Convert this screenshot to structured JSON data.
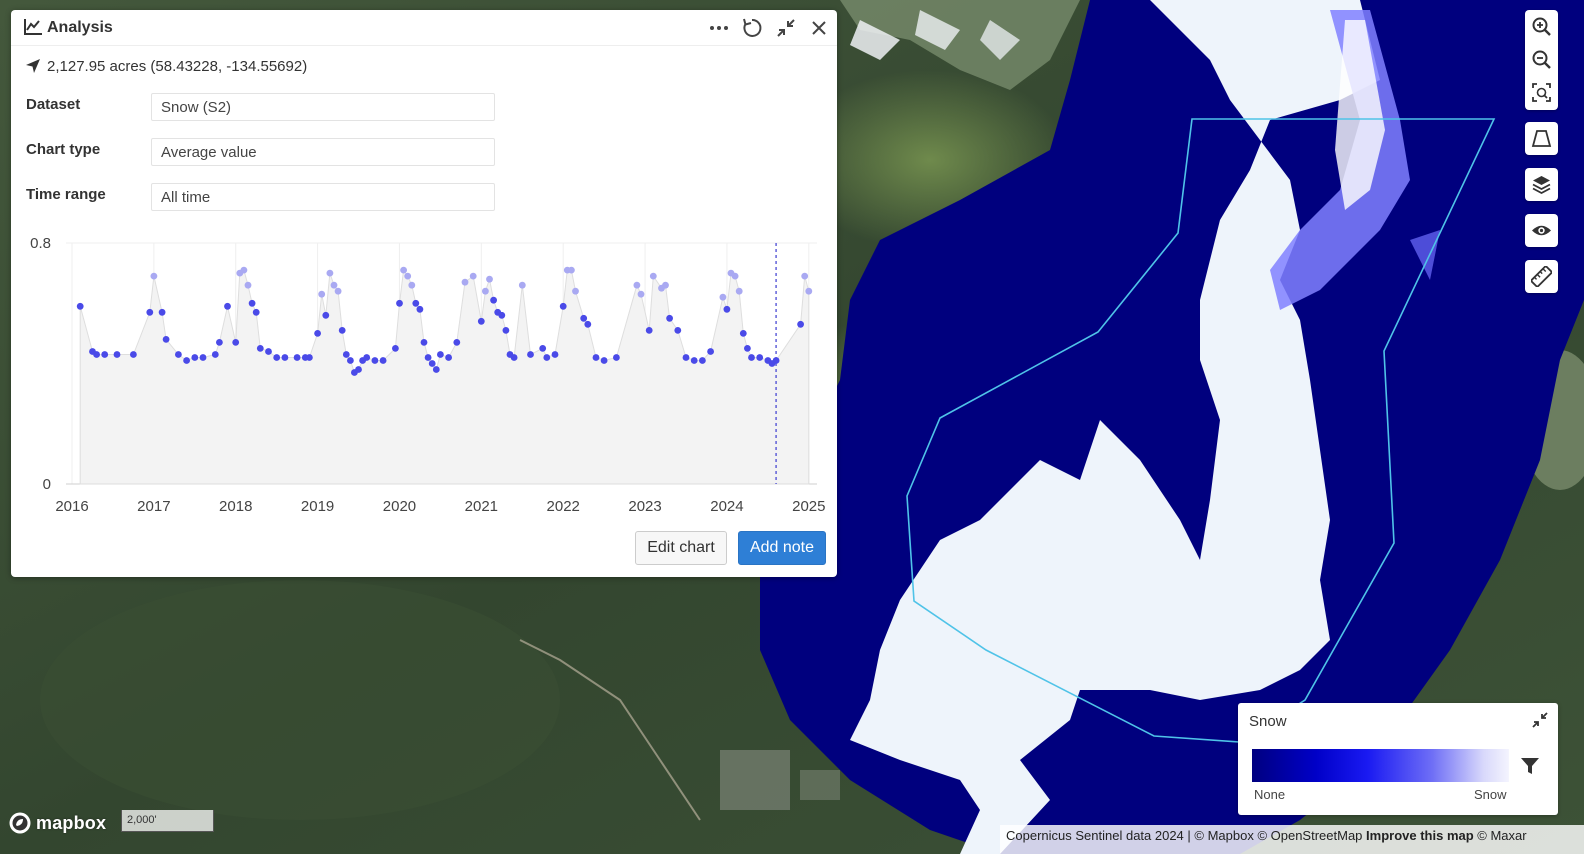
{
  "panel": {
    "title": "Analysis",
    "coords": "2,127.95 acres (58.43228, -134.55692)",
    "fields": [
      {
        "label": "Dataset",
        "value": "Snow (S2)"
      },
      {
        "label": "Chart type",
        "value": "Average value"
      },
      {
        "label": "Time range",
        "value": "All time"
      }
    ],
    "edit_chart_label": "Edit chart",
    "add_note_label": "Add note"
  },
  "chart_data": {
    "type": "scatter",
    "title": "",
    "xlabel": "",
    "ylabel": "",
    "x_ticks": [
      "2016",
      "2017",
      "2018",
      "2019",
      "2020",
      "2021",
      "2022",
      "2023",
      "2024",
      "2025"
    ],
    "y_ticks": [
      "0",
      "0.8"
    ],
    "xlim": [
      2016.0,
      2025.1
    ],
    "ylim": [
      0,
      0.8
    ],
    "marker_line_x": 2024.6,
    "series": [
      {
        "x": [
          2016.1,
          2016.25,
          2016.3,
          2016.4,
          2016.55,
          2016.75,
          2016.95,
          2017.0,
          2017.1,
          2017.15,
          2017.3,
          2017.4,
          2017.5,
          2017.6,
          2017.75,
          2017.8,
          2017.9,
          2018.0,
          2018.05,
          2018.1,
          2018.15,
          2018.2,
          2018.25,
          2018.3,
          2018.4,
          2018.5,
          2018.6,
          2018.75,
          2018.85,
          2018.9,
          2019.0,
          2019.05,
          2019.1,
          2019.15,
          2019.2,
          2019.25,
          2019.3,
          2019.35,
          2019.4,
          2019.45,
          2019.5,
          2019.55,
          2019.6,
          2019.7,
          2019.8,
          2019.95,
          2020.0,
          2020.05,
          2020.1,
          2020.15,
          2020.2,
          2020.25,
          2020.3,
          2020.35,
          2020.4,
          2020.45,
          2020.5,
          2020.6,
          2020.7,
          2020.8,
          2020.9,
          2021.0,
          2021.05,
          2021.1,
          2021.15,
          2021.2,
          2021.25,
          2021.3,
          2021.35,
          2021.4,
          2021.5,
          2021.6,
          2021.75,
          2021.8,
          2021.9,
          2022.0,
          2022.05,
          2022.1,
          2022.15,
          2022.25,
          2022.3,
          2022.4,
          2022.5,
          2022.65,
          2022.9,
          2022.95,
          2023.05,
          2023.1,
          2023.2,
          2023.25,
          2023.3,
          2023.4,
          2023.5,
          2023.6,
          2023.7,
          2023.8,
          2023.95,
          2024.0,
          2024.05,
          2024.1,
          2024.15,
          2024.2,
          2024.25,
          2024.3,
          2024.4,
          2024.5,
          2024.55,
          2024.6,
          2024.9,
          2024.95,
          2025.0
        ],
        "y": [
          0.59,
          0.44,
          0.43,
          0.43,
          0.43,
          0.43,
          0.57,
          0.69,
          0.57,
          0.48,
          0.43,
          0.41,
          0.42,
          0.42,
          0.43,
          0.47,
          0.59,
          0.47,
          0.7,
          0.71,
          0.66,
          0.6,
          0.57,
          0.45,
          0.44,
          0.42,
          0.42,
          0.42,
          0.42,
          0.42,
          0.5,
          0.63,
          0.56,
          0.7,
          0.66,
          0.64,
          0.51,
          0.43,
          0.41,
          0.37,
          0.38,
          0.41,
          0.42,
          0.41,
          0.41,
          0.45,
          0.6,
          0.71,
          0.69,
          0.66,
          0.6,
          0.58,
          0.47,
          0.42,
          0.4,
          0.38,
          0.43,
          0.42,
          0.47,
          0.67,
          0.69,
          0.54,
          0.64,
          0.68,
          0.61,
          0.57,
          0.56,
          0.51,
          0.43,
          0.42,
          0.66,
          0.43,
          0.45,
          0.42,
          0.43,
          0.59,
          0.71,
          0.71,
          0.64,
          0.55,
          0.53,
          0.42,
          0.41,
          0.42,
          0.66,
          0.63,
          0.51,
          0.69,
          0.65,
          0.66,
          0.55,
          0.51,
          0.42,
          0.41,
          0.41,
          0.44,
          0.62,
          0.58,
          0.7,
          0.69,
          0.64,
          0.5,
          0.45,
          0.42,
          0.42,
          0.41,
          0.4,
          0.41,
          0.53,
          0.69,
          0.64
        ]
      }
    ]
  },
  "legend": {
    "title": "Snow",
    "min_label": "None",
    "max_label": "Snow"
  },
  "map": {
    "logo_text": "mapbox",
    "scale_text": "2,000'",
    "attribution_prefix": "Copernicus Sentinel data 2024 | © Mapbox © OpenStreetMap ",
    "attribution_improve": "Improve this map",
    "attribution_suffix": " © Maxar"
  },
  "toolbar": {
    "icons": [
      "zoom-in-icon",
      "zoom-out-icon",
      "fit-bounds-icon",
      "draw-polygon-icon",
      "layers-icon",
      "visibility-icon",
      "ruler-icon"
    ]
  },
  "colors": {
    "accent_blue": "#2e7fd6",
    "chart_point": "#4a4ae8",
    "chart_point_light": "#a9a9f2",
    "snow_dark": "#00007e"
  }
}
